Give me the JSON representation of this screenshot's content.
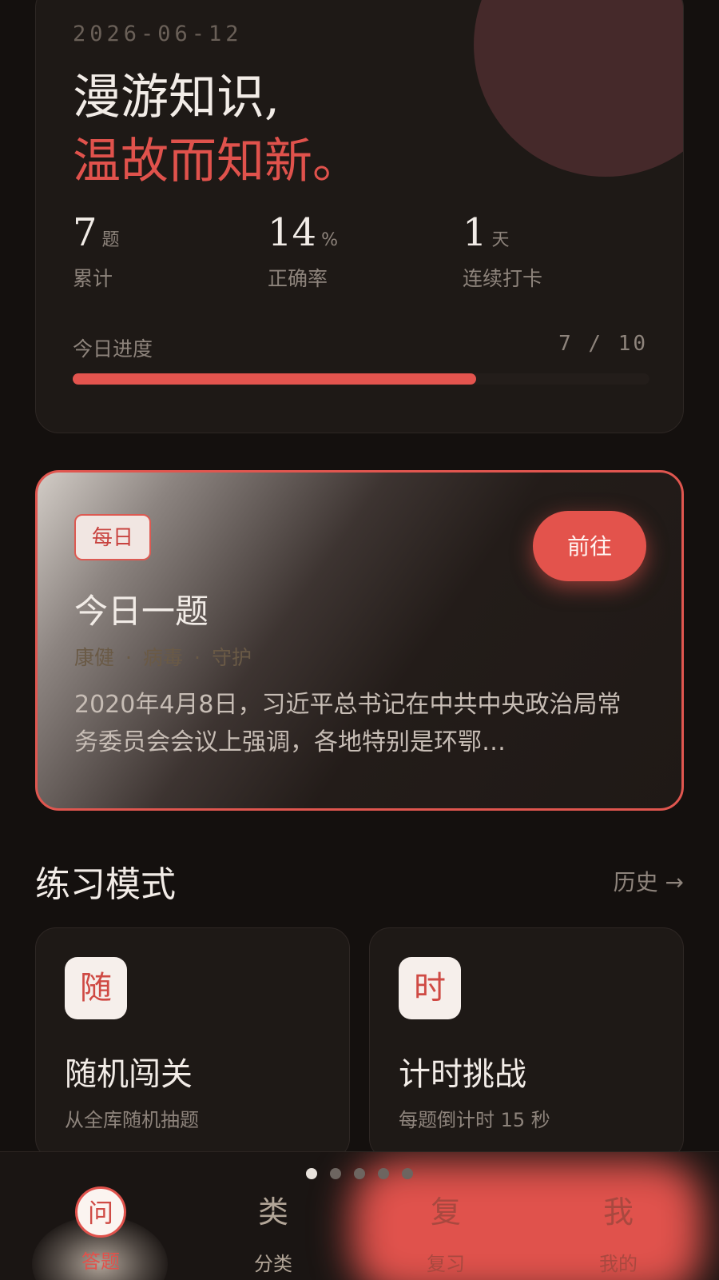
{
  "hero": {
    "date": "2026-06-12",
    "line1": "漫游知识,",
    "line2": "温故而知新。",
    "stats": [
      {
        "value": "7",
        "unit": "题",
        "label": "累计"
      },
      {
        "value": "14",
        "unit": "%",
        "label": "正确率"
      },
      {
        "value": "1",
        "unit": "天",
        "label": "连续打卡"
      }
    ],
    "progress_label": "今日进度",
    "progress_done": 7,
    "progress_total": 10,
    "progress_text": "7 / 10"
  },
  "daily": {
    "badge": "每日",
    "go_label": "前往",
    "title": "今日一题",
    "tags": [
      "康健",
      "病毒",
      "守护"
    ],
    "body": "2020年4月8日，习近平总书记在中共中央政治局常务委员会会议上强调，各地特别是环鄂…"
  },
  "practice": {
    "title": "练习模式",
    "history": "历史 →",
    "modes": [
      {
        "icon_char": "随",
        "title": "随机闯关",
        "desc": "从全库随机抽题"
      },
      {
        "icon_char": "时",
        "title": "计时挑战",
        "desc": "每题倒计时 15 秒"
      }
    ]
  },
  "pager": {
    "count": 5,
    "active": 0
  },
  "nav": [
    {
      "icon_char": "问",
      "label": "答题",
      "active": true
    },
    {
      "icon_char": "类",
      "label": "分类",
      "active": false
    },
    {
      "icon_char": "复",
      "label": "复习",
      "active": false
    },
    {
      "icon_char": "我",
      "label": "我的",
      "active": false
    }
  ],
  "colors": {
    "accent": "#e3544e",
    "background": "#14100e",
    "card": "#1e1916"
  }
}
